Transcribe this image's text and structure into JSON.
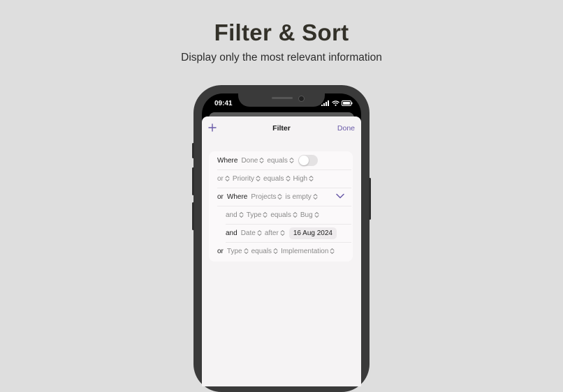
{
  "header": {
    "title": "Filter & Sort",
    "subtitle": "Display only the most relevant information"
  },
  "status_bar": {
    "time": "09:41"
  },
  "nav": {
    "add_icon": "plus-icon",
    "title": "Filter",
    "done_label": "Done"
  },
  "rules": {
    "r1": {
      "keyword": "Where",
      "field": "Done",
      "operator": "equals",
      "toggle_on": false
    },
    "r2": {
      "keyword": "or",
      "field": "Priority",
      "operator": "equals",
      "value": "High"
    },
    "r3": {
      "keyword1": "or",
      "keyword2": "Where",
      "field": "Projects",
      "operator": "is empty"
    },
    "r4": {
      "keyword": "and",
      "field": "Type",
      "operator": "equals",
      "value": "Bug"
    },
    "r5": {
      "keyword": "and",
      "field": "Date",
      "operator": "after",
      "value": "16 Aug 2024"
    },
    "r6": {
      "keyword": "or",
      "field": "Type",
      "operator": "equals",
      "value": "Implementation"
    }
  },
  "colors": {
    "accent": "#6a5aa8",
    "background": "#dedede",
    "sheet": "#f5f3f4"
  }
}
